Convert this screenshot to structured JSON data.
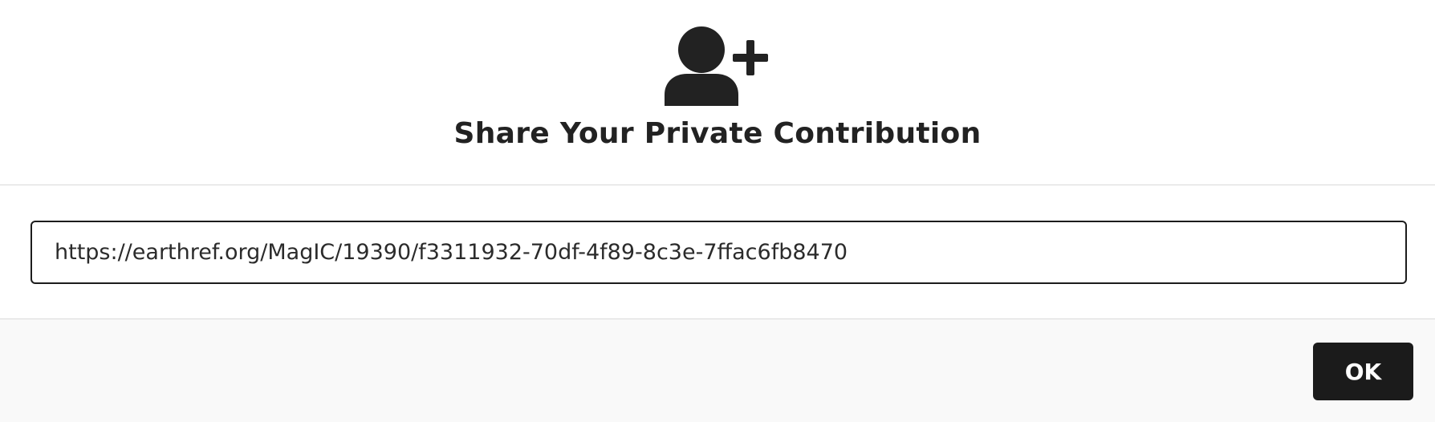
{
  "modal": {
    "header": {
      "icon": "user-plus-icon",
      "title": "Share Your Private Contribution"
    },
    "content": {
      "share_link": "https://earthref.org/MagIC/19390/f3311932-70df-4f89-8c3e-7ffac6fb8470"
    },
    "footer": {
      "ok_label": "OK"
    }
  }
}
